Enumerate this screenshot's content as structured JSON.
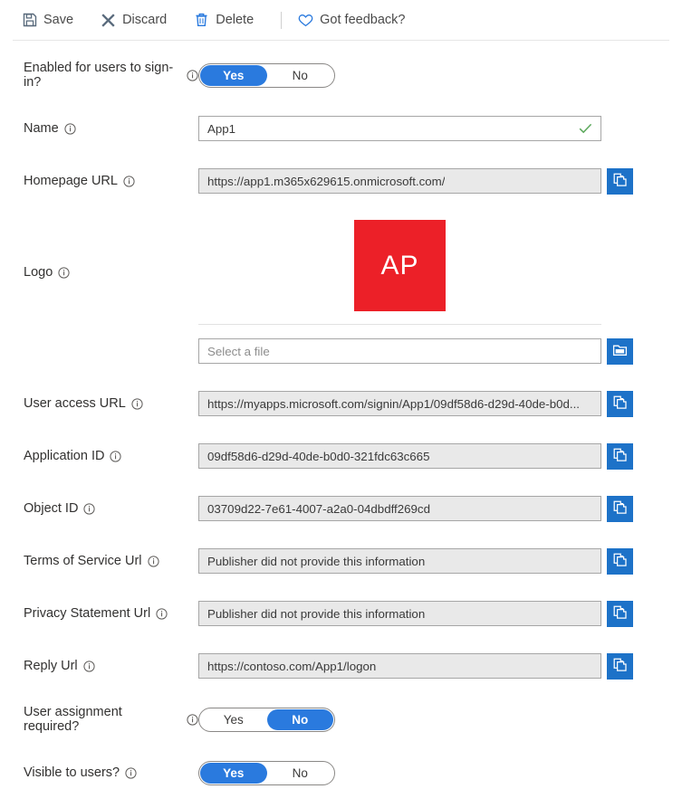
{
  "toolbar": {
    "save": {
      "label": "Save",
      "icon": "save-icon"
    },
    "discard": {
      "label": "Discard",
      "icon": "discard-icon"
    },
    "delete": {
      "label": "Delete",
      "icon": "trash-icon"
    },
    "feedback": {
      "label": "Got feedback?",
      "icon": "heart-icon"
    }
  },
  "colors": {
    "accent_blue": "#2a7ade",
    "button_blue": "#1d72c8",
    "logo_red": "#ec2028",
    "check_green": "#5ba85b"
  },
  "fields": {
    "enabled_signin": {
      "label": "Enabled for users to sign-in?",
      "type": "toggle",
      "options": [
        "Yes",
        "No"
      ],
      "value": "Yes"
    },
    "name": {
      "label": "Name",
      "type": "text",
      "value": "App1",
      "readonly": false,
      "validated": true
    },
    "homepage_url": {
      "label": "Homepage URL",
      "type": "text",
      "value": "https://app1.m365x629615.onmicrosoft.com/",
      "readonly": true,
      "copy_button": "copy-icon"
    },
    "logo": {
      "label": "Logo",
      "type": "image",
      "initials": "AP",
      "file_placeholder": "Select a file",
      "browse_button": "folder-icon"
    },
    "user_access_url": {
      "label": "User access URL",
      "type": "text",
      "value": "https://myapps.microsoft.com/signin/App1/09df58d6-d29d-40de-b0d...",
      "readonly": true,
      "copy_button": "copy-icon"
    },
    "application_id": {
      "label": "Application ID",
      "type": "text",
      "value": "09df58d6-d29d-40de-b0d0-321fdc63c665",
      "readonly": true,
      "copy_button": "copy-icon"
    },
    "object_id": {
      "label": "Object ID",
      "type": "text",
      "value": "03709d22-7e61-4007-a2a0-04dbdff269cd",
      "readonly": true,
      "copy_button": "copy-icon"
    },
    "terms_of_service_url": {
      "label": "Terms of Service Url",
      "type": "text",
      "value": "Publisher did not provide this information",
      "readonly": true,
      "copy_button": "copy-icon"
    },
    "privacy_statement_url": {
      "label": "Privacy Statement Url",
      "type": "text",
      "value": "Publisher did not provide this information",
      "readonly": true,
      "copy_button": "copy-icon"
    },
    "reply_url": {
      "label": "Reply Url",
      "type": "text",
      "value": "https://contoso.com/App1/logon",
      "readonly": true,
      "copy_button": "copy-icon"
    },
    "user_assignment_required": {
      "label": "User assignment required?",
      "type": "toggle",
      "options": [
        "Yes",
        "No"
      ],
      "value": "No"
    },
    "visible_to_users": {
      "label": "Visible to users?",
      "type": "toggle",
      "options": [
        "Yes",
        "No"
      ],
      "value": "Yes"
    }
  }
}
